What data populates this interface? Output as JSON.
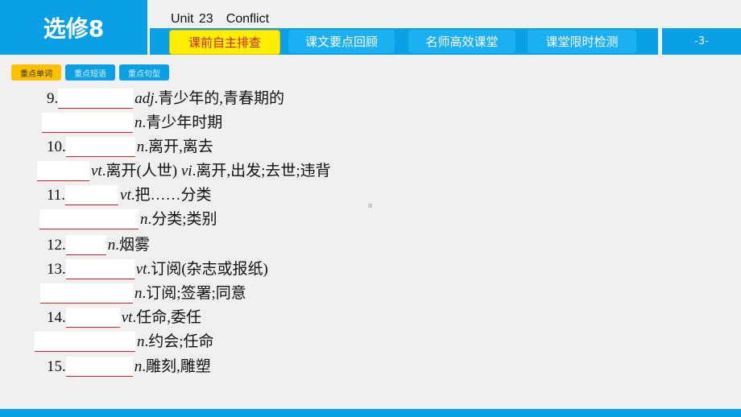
{
  "header": {
    "logo": "选修8",
    "unit": "Unit 23　Conflict",
    "page": "-3-"
  },
  "tabs": [
    {
      "label": "课前自主排查",
      "active": true
    },
    {
      "label": "课文要点回顾"
    },
    {
      "label": "名师高效课堂"
    },
    {
      "label": "课堂限时检测"
    }
  ],
  "subtabs": [
    {
      "label": "重点单词",
      "active": true
    },
    {
      "label": "重点短语"
    },
    {
      "label": "重点句型"
    }
  ],
  "accent": "#0aa0e6",
  "highlight": "#ffee00",
  "items": [
    {
      "num": "9.",
      "pos": "adj",
      "meaning": ".青少年的,青春期的"
    },
    {
      "num": "",
      "pos": "n",
      "meaning": ".青少年时期"
    },
    {
      "num": "10.",
      "pos": "n",
      "meaning": ".离开,离去"
    },
    {
      "num": "",
      "pos": "vt",
      "meaning": ".离开(人世) ",
      "pos2": "vi",
      "meaning2": ".离开,出发;去世;违背"
    },
    {
      "num": "11.",
      "pos": "vt",
      "meaning": ".把……分类"
    },
    {
      "num": "",
      "pos": "n",
      "meaning": ".分类;类别"
    },
    {
      "num": "12.",
      "pos": "n",
      "meaning": ".烟雾"
    },
    {
      "num": "13.",
      "pos": "vt",
      "meaning": ".订阅(杂志或报纸)"
    },
    {
      "num": "",
      "pos": "n",
      "meaning": ".订阅;签署;同意"
    },
    {
      "num": "14.",
      "pos": "vt",
      "meaning": ".任命,委任"
    },
    {
      "num": "",
      "pos": "n",
      "meaning": ".约会;任命"
    },
    {
      "num": "15.",
      "pos": "n",
      "meaning": ".雕刻,雕塑"
    }
  ]
}
